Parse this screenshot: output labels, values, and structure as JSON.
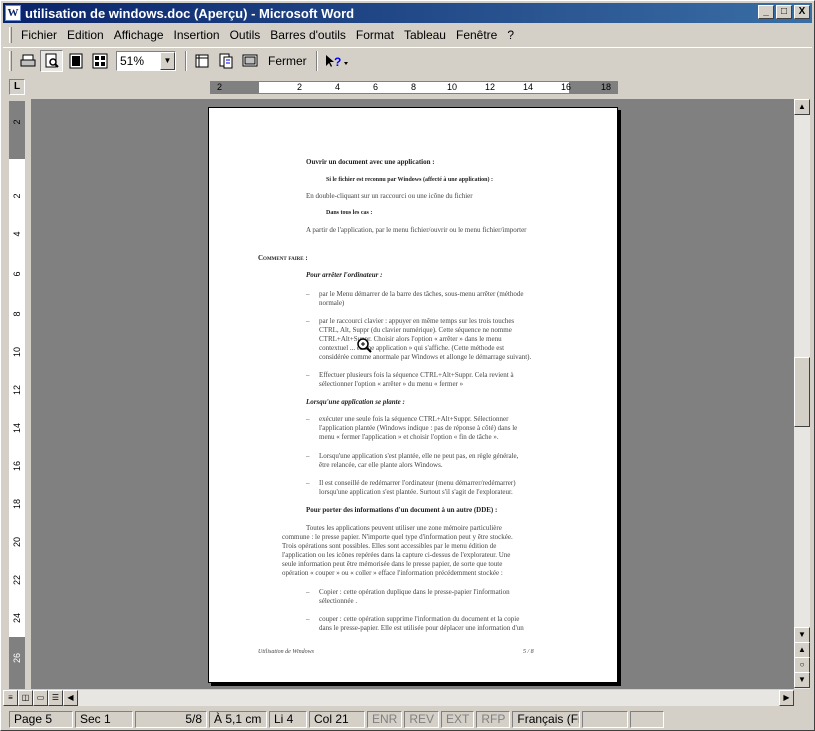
{
  "window": {
    "title": "utilisation de windows.doc (Aperçu) - Microsoft Word",
    "app_icon": "W",
    "controls": {
      "minimize": "_",
      "maximize": "□",
      "close": "X"
    }
  },
  "menu": [
    "Fichier",
    "Edition",
    "Affichage",
    "Insertion",
    "Outils",
    "Barres d'outils",
    "Format",
    "Tableau",
    "Fenêtre",
    "?"
  ],
  "toolbar": {
    "zoom": "51%",
    "close_label": "Fermer"
  },
  "ruler": {
    "h": [
      "2",
      "2",
      "4",
      "6",
      "8",
      "10",
      "12",
      "14",
      "16",
      "18"
    ],
    "v": [
      "2",
      "2",
      "4",
      "6",
      "8",
      "10",
      "12",
      "14",
      "16",
      "18",
      "20",
      "22",
      "24",
      "26"
    ]
  },
  "page": {
    "h1": "Ouvrir un document avec une application :",
    "p1": "Si le fichier est reconnu par Windows (affecté à une application) :",
    "p2": "En double-cliquant sur un raccourci ou une icône du fichier",
    "p3": "Dans tous les cas :",
    "p4": "A partir de l'application, par le menu fichier/ouvrir ou le menu fichier/importer",
    "h2": "Comment faire :",
    "h3": "Pour arrêter l'ordinateur :",
    "b1": [
      "–",
      "par le Menu démarrer de la barre des tâches, sous-menu arrêter (méthode",
      "normale)"
    ],
    "b2": [
      "–",
      "par le raccourci clavier : appuyer en même temps sur les trois touches",
      "CTRL, Alt, Suppr (du clavier numérique). Cette séquence ne nomme",
      "CTRL+Alt+Suppr. Choisir alors l'option « arrêter » dans le menu",
      "contextuel ... er une application » qui s'affiche. (Cette méthode est",
      "considérée comme anormale par Windows et allonge le démarrage suivant)."
    ],
    "b3": [
      "–",
      "Effectuer plusieurs fois la séquence CTRL+Alt+Suppr. Cela revient à",
      "sélectionner l'option « arrêter » du menu « fermer »"
    ],
    "h4": "Lorsqu'une application se plante :",
    "b4": [
      "–",
      "exécuter une seule fois la séquence CTRL+Alt+Suppr. Sélectionner",
      "l'application plantée (Windows indique : pas de réponse à côté) dans le",
      "menu « fermer l'application » et choisir l'option « fin de tâche »."
    ],
    "b5": [
      "–",
      "Lorsqu'une application s'est plantée, elle ne peut pas, en règle générale,",
      "être relancée, car elle plante alors Windows."
    ],
    "b6": [
      "–",
      "Il est conseillé de redémarrer l'ordinateur (menu démarrer/redémarrer)",
      "lorsqu'une application s'est plantée. Surtout s'il s'agit de l'explorateur."
    ],
    "h5": "Pour porter des informations d'un document à un autre (DDE) :",
    "para": [
      "Toutes les applications peuvent utiliser une zone mémoire particulière",
      "commune : le presse papier. N'importe quel type d'information peut y être stockée.",
      "Trois opérations sont possibles. Elles sont accessibles par le menu édition de",
      "l'application ou les icônes repérées dans la capture ci-dessus de l'explorateur. Une",
      "seule information peut être mémorisée dans le presse papier, de sorte que toute",
      "opération « couper » ou « coller » efface l'information précédemment stockée :"
    ],
    "b7": [
      "–",
      "Copier : cette opération duplique dans le presse-papier l'information",
      "sélectionnée ."
    ],
    "b8": [
      "–",
      "couper : cette opération supprime l'information du document et la copie",
      "dans le presse-papier. Elle est utilisée pour déplacer une information d'un"
    ],
    "footer_left": "Utilisation de Windows",
    "footer_right": "5 / 8"
  },
  "status": {
    "page": "Page 5",
    "sec": "Sec 1",
    "pages": "5/8",
    "at": "À 5,1 cm",
    "line": "Li 4",
    "col": "Col 21",
    "enr": "ENR",
    "rev": "REV",
    "ext": "EXT",
    "rfp": "RFP",
    "lang": "Français (Fr"
  }
}
